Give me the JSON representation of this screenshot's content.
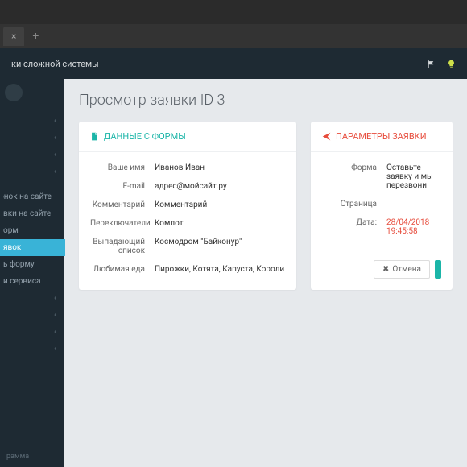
{
  "browser": {
    "tab_close": "×",
    "tab_new": "+"
  },
  "header": {
    "title": "ки сложной системы"
  },
  "sidebar": {
    "items": [
      {
        "label": "",
        "chev": "‹"
      },
      {
        "label": "",
        "chev": "‹"
      },
      {
        "label": "",
        "chev": "‹"
      },
      {
        "label": "",
        "chev": "‹"
      },
      {
        "label": "",
        "chev": ""
      },
      {
        "label": "вонок на сайте",
        "chev": ""
      },
      {
        "label": "вки на сайте",
        "chev": ""
      },
      {
        "label": "орм",
        "chev": ""
      },
      {
        "label": "явок",
        "chev": ""
      },
      {
        "label": "ь форму",
        "chev": ""
      },
      {
        "label": "и сервиса",
        "chev": ""
      },
      {
        "label": "",
        "chev": "‹"
      },
      {
        "label": "",
        "chev": "‹"
      },
      {
        "label": "",
        "chev": "‹"
      },
      {
        "label": "",
        "chev": "‹"
      }
    ],
    "bottom": "рамма"
  },
  "page": {
    "title": "Просмотр заявки ID 3"
  },
  "form_panel": {
    "title": "ДАННЫЕ С ФОРМЫ",
    "rows": [
      {
        "label": "Ваше имя",
        "value": "Иванов Иван"
      },
      {
        "label": "E-mail",
        "value": "адрес@мойсайт.ру"
      },
      {
        "label": "Комментарий",
        "value": "Комментарий"
      },
      {
        "label": "Переключатели",
        "value": "Компот"
      },
      {
        "label": "Выпадающий список",
        "value": "Космодром \"Байконур\""
      },
      {
        "label": "Любимая еда",
        "value": "Пирожки, Котята, Капуста, Короли"
      }
    ]
  },
  "params_panel": {
    "title": "ПАРАМЕТРЫ ЗАЯВКИ",
    "rows": [
      {
        "label": "Форма",
        "value": "Оставьте заявку и мы перезвони"
      },
      {
        "label": "Страница",
        "value": ""
      },
      {
        "label": "Дата:",
        "value": "28/04/2018 19:45:58",
        "red": true
      }
    ],
    "cancel": "Отмена"
  }
}
